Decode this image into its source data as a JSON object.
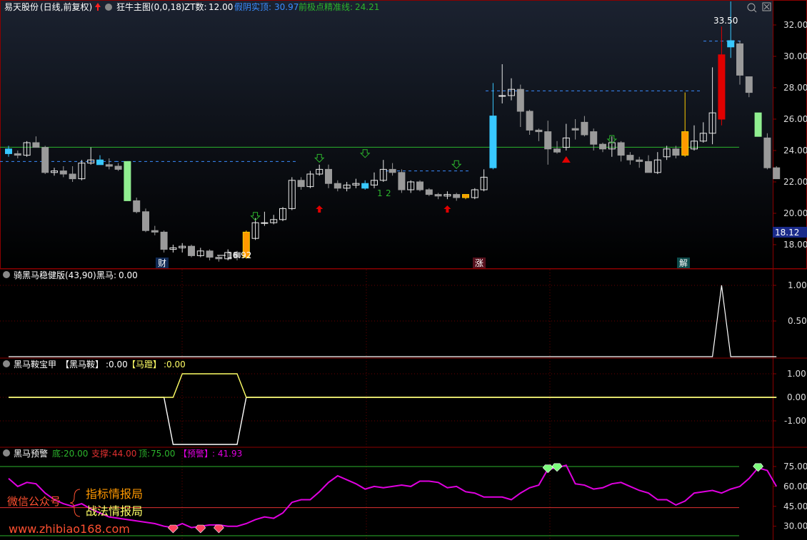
{
  "colors": {
    "bg": "#000000",
    "border": "#8b0000",
    "grid": "#6b0000",
    "up": "#e00000",
    "down": "#9a9a9a",
    "white": "#ffffff",
    "yellow": "#ffff66",
    "magenta": "#e000e0",
    "green": "#2cb52c",
    "blue": "#3a8dff",
    "cyan": "#38c8ff",
    "orange": "#ff9900"
  },
  "panel1": {
    "header": {
      "stock": "易天股份",
      "period": "(日线,前复权)",
      "indicator": "狂牛主图(0,0,18)",
      "zt_label": "ZT数:",
      "zt_value": "12.00",
      "rise_label": "假阴实顶:",
      "rise_value": "30.97",
      "base_label": "前极点精准线:",
      "base_value": "24.21"
    },
    "axis": {
      "ticks": [
        "32.00",
        "30.00",
        "28.00",
        "26.00",
        "24.00",
        "22.00",
        "20.00",
        "18.00"
      ],
      "current": "18.12"
    },
    "high_label": "33.50",
    "low_label": "16.92",
    "badges": [
      "财",
      "涨",
      "解"
    ],
    "counts": [
      "1",
      "2"
    ]
  },
  "panel2": {
    "header": {
      "name": "骑黑马稳健版(43,90)",
      "field": "黑马:",
      "value": "0.00"
    },
    "axis": {
      "ticks": [
        "1.00",
        "0.50"
      ]
    }
  },
  "panel3": {
    "header": {
      "name": "黑马鞍宝甲",
      "f1": "【黑马鞍】",
      "v1": ":0.00",
      "f2": "【马蹬】",
      "v2": ":0.00"
    },
    "axis": {
      "ticks": [
        "1.00",
        "0.00",
        "-1.00"
      ]
    }
  },
  "panel4": {
    "header": {
      "name": "黑马预警",
      "b_label": "底:",
      "b_value": "20.00",
      "s_label": "支撑:",
      "s_value": "44.00",
      "t_label": "顶:",
      "t_value": "75.00",
      "w_label": "【预警】",
      "w_value": ": 41.93"
    },
    "axis": {
      "ticks": [
        "75.00",
        "60.00",
        "45.00",
        "30.00"
      ]
    },
    "watermark": {
      "wechat": "微信公众号",
      "l1": "指标情报局",
      "l2": "战法情报局",
      "url": "www.zhibiao168.com"
    }
  },
  "chart_data": [
    {
      "type": "candlestick",
      "title": "狂牛主图(0,0,18)",
      "ylim": [
        16.5,
        33.5
      ],
      "series": [
        {
          "name": "OHLC",
          "values": [
            [
              24.1,
              24.3,
              23.6,
              23.8
            ],
            [
              23.8,
              24.0,
              23.5,
              23.7
            ],
            [
              23.7,
              24.6,
              23.6,
              24.5
            ],
            [
              24.5,
              24.9,
              24.2,
              24.2
            ],
            [
              24.2,
              24.3,
              22.5,
              22.6
            ],
            [
              22.6,
              22.9,
              22.4,
              22.7
            ],
            [
              22.7,
              23.0,
              22.3,
              22.5
            ],
            [
              22.5,
              23.0,
              22.0,
              22.2
            ],
            [
              22.2,
              23.4,
              22.1,
              23.2
            ],
            [
              23.2,
              24.2,
              23.1,
              23.4
            ],
            [
              23.4,
              23.7,
              23.1,
              23.1
            ],
            [
              23.1,
              23.5,
              22.8,
              23.0
            ],
            [
              23.0,
              23.2,
              22.7,
              22.8
            ],
            [
              23.3,
              23.3,
              20.8,
              20.8
            ],
            [
              20.8,
              21.0,
              20.0,
              20.1
            ],
            [
              20.1,
              20.3,
              18.8,
              18.9
            ],
            [
              18.9,
              19.2,
              18.6,
              18.8
            ],
            [
              18.8,
              18.9,
              17.5,
              17.7
            ],
            [
              17.7,
              18.0,
              17.5,
              17.8
            ],
            [
              17.8,
              18.1,
              17.5,
              17.9
            ],
            [
              17.9,
              18.0,
              17.2,
              17.3
            ],
            [
              17.3,
              17.8,
              17.2,
              17.6
            ],
            [
              17.6,
              17.7,
              17.0,
              17.2
            ],
            [
              17.2,
              17.3,
              16.92,
              17.1
            ],
            [
              17.1,
              17.7,
              17.0,
              17.5
            ],
            [
              17.5,
              17.6,
              17.0,
              17.2
            ],
            [
              17.2,
              18.9,
              17.1,
              18.8
            ],
            [
              18.4,
              19.7,
              18.3,
              19.4
            ],
            [
              19.4,
              20.1,
              19.2,
              19.4
            ],
            [
              19.4,
              19.9,
              19.3,
              19.6
            ],
            [
              19.6,
              20.4,
              19.5,
              20.3
            ],
            [
              20.3,
              22.3,
              20.2,
              22.1
            ],
            [
              22.1,
              22.3,
              21.5,
              21.7
            ],
            [
              21.7,
              22.7,
              21.6,
              22.5
            ],
            [
              22.5,
              23.1,
              22.4,
              22.8
            ],
            [
              22.8,
              23.1,
              21.6,
              21.9
            ],
            [
              21.9,
              22.1,
              21.4,
              21.6
            ],
            [
              21.6,
              22.0,
              21.4,
              21.8
            ],
            [
              21.8,
              22.2,
              21.6,
              21.9
            ],
            [
              21.9,
              22.1,
              21.5,
              21.6
            ],
            [
              21.8,
              22.6,
              21.6,
              22.1
            ],
            [
              22.1,
              23.4,
              22.0,
              22.8
            ],
            [
              22.8,
              23.2,
              22.4,
              22.6
            ],
            [
              22.6,
              22.8,
              21.3,
              21.5
            ],
            [
              21.5,
              22.1,
              21.3,
              22.0
            ],
            [
              22.0,
              22.1,
              21.4,
              21.5
            ],
            [
              21.5,
              21.6,
              21.1,
              21.2
            ],
            [
              21.2,
              21.3,
              20.9,
              21.1
            ],
            [
              21.1,
              21.4,
              20.9,
              21.2
            ],
            [
              21.2,
              21.3,
              20.8,
              21.0
            ],
            [
              21.0,
              21.2,
              20.9,
              21.2
            ],
            [
              21.0,
              21.6,
              20.9,
              21.5
            ],
            [
              21.5,
              22.8,
              21.4,
              22.3
            ],
            [
              22.9,
              28.3,
              22.8,
              26.2
            ],
            [
              27.5,
              29.5,
              27.0,
              27.5
            ],
            [
              27.5,
              28.6,
              27.2,
              27.9
            ],
            [
              27.9,
              28.2,
              25.5,
              26.5
            ],
            [
              26.5,
              26.6,
              25.0,
              25.3
            ],
            [
              25.3,
              25.4,
              24.6,
              25.2
            ],
            [
              25.2,
              25.9,
              23.1,
              24.1
            ],
            [
              24.1,
              24.6,
              23.8,
              23.9
            ],
            [
              24.2,
              25.7,
              24.0,
              24.8
            ],
            [
              25.4,
              26.0,
              24.7,
              25.3
            ],
            [
              25.8,
              26.2,
              24.9,
              25.0
            ],
            [
              25.2,
              25.4,
              24.0,
              24.4
            ],
            [
              24.4,
              24.5,
              23.9,
              24.1
            ],
            [
              24.1,
              24.9,
              23.6,
              24.5
            ],
            [
              24.5,
              24.6,
              23.3,
              23.7
            ],
            [
              23.7,
              23.9,
              23.1,
              23.4
            ],
            [
              23.4,
              23.6,
              22.9,
              23.3
            ],
            [
              23.3,
              23.7,
              22.6,
              22.6
            ],
            [
              22.6,
              23.9,
              22.5,
              23.4
            ],
            [
              23.6,
              24.3,
              23.4,
              24.1
            ],
            [
              24.1,
              24.3,
              23.5,
              23.7
            ],
            [
              23.7,
              27.7,
              23.6,
              25.2
            ],
            [
              24.1,
              25.6,
              24.0,
              24.6
            ],
            [
              24.6,
              25.8,
              24.5,
              25.1
            ],
            [
              25.1,
              29.3,
              24.4,
              26.4
            ],
            [
              26.0,
              31.9,
              25.6,
              30.1
            ],
            [
              30.6,
              33.5,
              29.9,
              31.0
            ],
            [
              30.8,
              31.0,
              28.2,
              28.8
            ],
            [
              28.7,
              28.7,
              27.4,
              27.7
            ],
            [
              26.4,
              26.4,
              24.9,
              24.9
            ],
            [
              24.8,
              25.1,
              22.8,
              22.9
            ],
            [
              22.9,
              23.0,
              22.2,
              22.2
            ]
          ]
        }
      ]
    },
    {
      "type": "line",
      "title": "骑黑马稳健版(43,90)",
      "ylim": [
        0,
        1.2
      ],
      "series": [
        {
          "name": "黑马",
          "values": [
            0,
            0,
            0,
            0,
            0,
            0,
            0,
            0,
            0,
            0,
            0,
            0,
            0,
            0,
            0,
            0,
            0,
            0,
            0,
            0,
            0,
            0,
            0,
            0,
            0,
            0,
            0,
            0,
            0,
            0,
            0,
            0,
            0,
            0,
            0,
            0,
            0,
            0,
            0,
            0,
            0,
            0,
            0,
            0,
            0,
            0,
            0,
            0,
            0,
            0,
            0,
            0,
            0,
            0,
            0,
            0,
            0,
            0,
            0,
            0,
            0,
            0,
            0,
            0,
            0,
            0,
            0,
            0,
            0,
            0,
            0,
            0,
            0,
            0,
            0,
            0,
            0,
            0,
            1,
            0,
            0,
            0,
            0,
            0,
            0
          ]
        }
      ]
    },
    {
      "type": "line",
      "title": "黑马鞍宝甲",
      "ylim": [
        -2,
        1.5
      ],
      "series": [
        {
          "name": "【黑马鞍】",
          "values": [
            0,
            0,
            0,
            0,
            0,
            0,
            0,
            0,
            0,
            0,
            0,
            0,
            0,
            0,
            0,
            0,
            0,
            0,
            -2,
            -2,
            -2,
            -2,
            -2,
            -2,
            -2,
            -2,
            0,
            0,
            0,
            0,
            0,
            0,
            0,
            0,
            0,
            0,
            0,
            0,
            0,
            0,
            0,
            0,
            0,
            0,
            0,
            0,
            0,
            0,
            0,
            0,
            0,
            0,
            0,
            0,
            0,
            0,
            0,
            0,
            0,
            0,
            0,
            0,
            0,
            0,
            0,
            0,
            0,
            0,
            0,
            0,
            0,
            0,
            0,
            0,
            0,
            0,
            0,
            0,
            0,
            0,
            0,
            0,
            0,
            0,
            0
          ]
        },
        {
          "name": "【马蹬】",
          "values": [
            0,
            0,
            0,
            0,
            0,
            0,
            0,
            0,
            0,
            0,
            0,
            0,
            0,
            0,
            0,
            0,
            0,
            0,
            0,
            1,
            1,
            1,
            1,
            1,
            1,
            1,
            0,
            0,
            0,
            0,
            0,
            0,
            0,
            0,
            0,
            0,
            0,
            0,
            0,
            0,
            0,
            0,
            0,
            0,
            0,
            0,
            0,
            0,
            0,
            0,
            0,
            0,
            0,
            0,
            0,
            0,
            0,
            0,
            0,
            0,
            0,
            0,
            0,
            0,
            0,
            0,
            0,
            0,
            0,
            0,
            0,
            0,
            0,
            0,
            0,
            0,
            0,
            0,
            0,
            0,
            0,
            0,
            0,
            0,
            0
          ]
        }
      ]
    },
    {
      "type": "line",
      "title": "黑马预警",
      "ylim": [
        18,
        85
      ],
      "series": [
        {
          "name": "【预警】",
          "values": [
            66,
            60,
            63,
            62,
            55,
            50,
            47,
            45,
            47,
            43,
            40,
            37,
            36,
            35,
            34,
            33,
            32,
            30,
            29,
            32,
            29,
            30,
            31,
            31,
            30,
            30,
            32,
            35,
            37,
            36,
            40,
            48,
            50,
            50,
            56,
            63,
            68,
            65,
            62,
            58,
            60,
            59,
            60,
            61,
            60,
            64,
            64,
            63,
            59,
            60,
            56,
            55,
            52,
            52,
            52,
            50,
            55,
            59,
            61,
            73,
            74,
            76,
            62,
            61,
            58,
            59,
            62,
            63,
            60,
            57,
            55,
            50,
            50,
            46,
            49,
            55,
            56,
            57,
            55,
            58,
            60,
            66,
            74,
            72,
            60
          ]
        },
        {
          "name": "顶",
          "values": [
            75
          ]
        },
        {
          "name": "支撑",
          "values": [
            44
          ]
        },
        {
          "name": "底",
          "values": [
            20
          ]
        }
      ]
    }
  ]
}
